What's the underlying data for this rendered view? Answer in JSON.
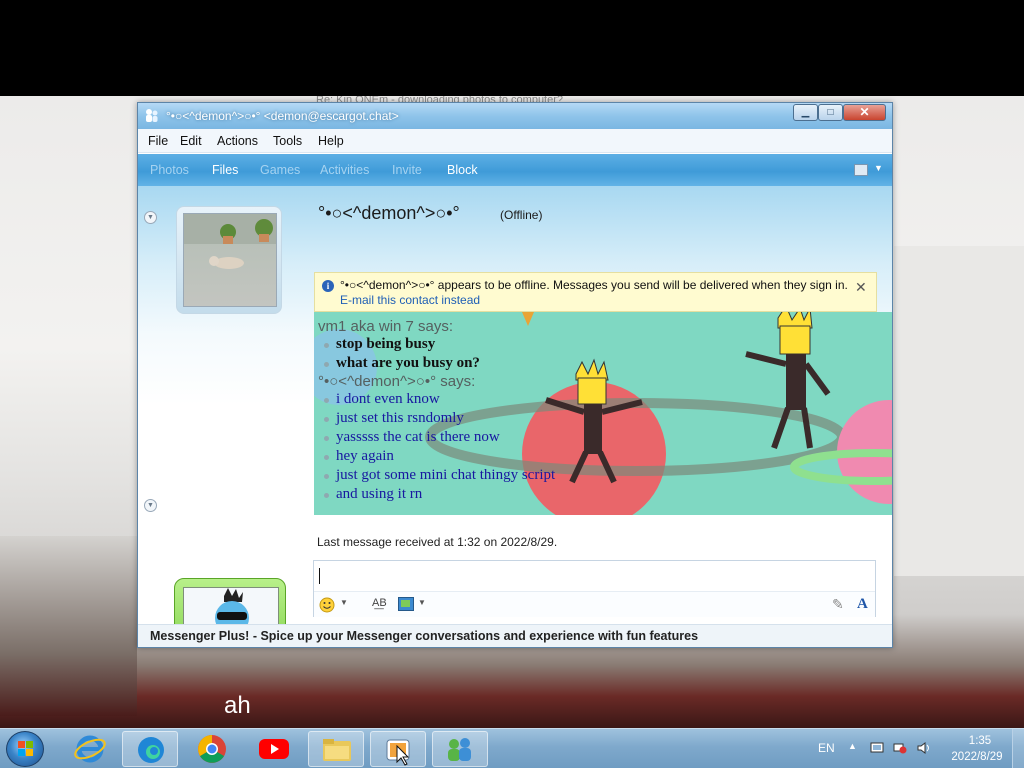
{
  "background": {
    "browser_tab_title": "Re: Kin ONEm - downloading photos to computer?",
    "subtitle": "ah"
  },
  "window": {
    "title": "°•○<^demon^>○•° <demon@escargot.chat>",
    "controls": {
      "minimize": "▁",
      "maximize": "□",
      "close": "✕"
    }
  },
  "menu": [
    "File",
    "Edit",
    "Actions",
    "Tools",
    "Help"
  ],
  "toolbar": {
    "items": [
      {
        "label": "Photos",
        "enabled": false
      },
      {
        "label": "Files",
        "enabled": true
      },
      {
        "label": "Games",
        "enabled": false
      },
      {
        "label": "Activities",
        "enabled": false
      },
      {
        "label": "Invite",
        "enabled": false
      },
      {
        "label": "Block",
        "enabled": true
      }
    ]
  },
  "contact": {
    "display_name": "°•○<^demon^>○•°",
    "status": "(Offline)"
  },
  "info_bar": {
    "message": "°•○<^demon^>○•° appears to be offline. Messages you send will be delivered when they sign in.",
    "link": "E-mail this contact instead",
    "close": "✕"
  },
  "conversation": [
    {
      "sender": "vm1 aka win 7 says:",
      "style": "bold",
      "messages": [
        "stop being busy",
        "what are you busy on?"
      ]
    },
    {
      "sender": "°•○<^demon^>○•° says:",
      "style": "blue",
      "messages": [
        "i dont even know",
        "just set this rsndomly",
        "yasssss the cat is there now",
        "hey again",
        "just got some mini chat thingy script",
        "and using it rn"
      ]
    }
  ],
  "last_received": "Last message received at 1:32 on 2022/8/29.",
  "compose": {
    "emoticon_icon": "smiley-icon",
    "text_icon": "font-icon",
    "bold_icon": "A"
  },
  "status_bar": {
    "ad": "Messenger Plus! - Spice up your Messenger conversations and experience with fun features"
  },
  "taskbar": {
    "language": "EN",
    "time": "1:35",
    "date": "2022/8/29"
  },
  "colors": {
    "toolbar_blue": "#3f9bd8",
    "chat_background": "#7fd8c2",
    "info_yellow": "#fffbd0",
    "outgoing_text": "#1818a0"
  }
}
